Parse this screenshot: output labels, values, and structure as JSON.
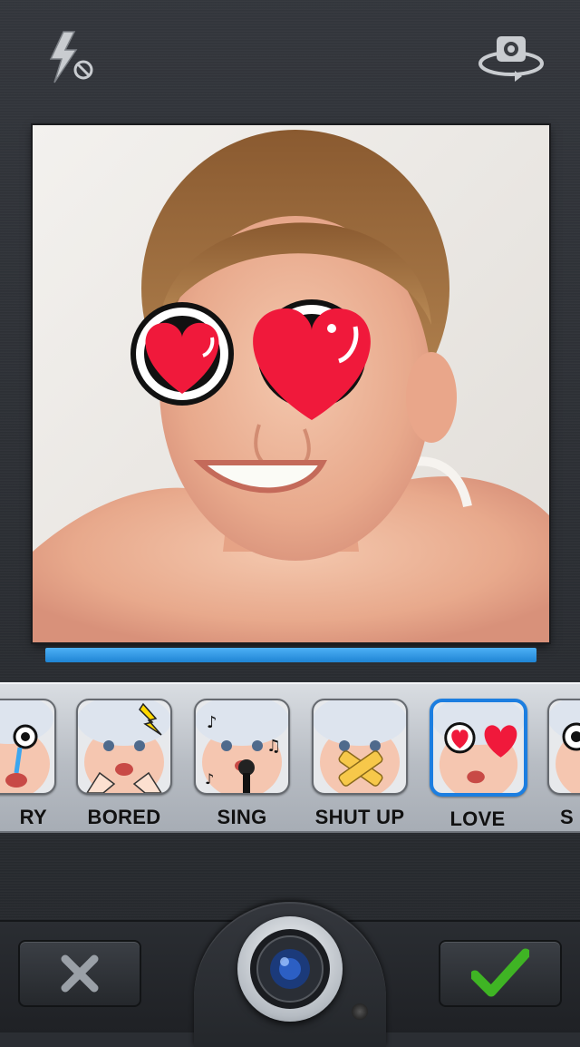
{
  "topbar": {
    "flash_icon": "flash-off-icon",
    "switch_camera_icon": "switch-camera-icon"
  },
  "preview": {
    "overlay": "heart-eyes",
    "progress": 1.0,
    "accent": "#1f84d4"
  },
  "stickers": [
    {
      "label": "CRY",
      "shown_label": "RY",
      "icon": "cry-face"
    },
    {
      "label": "BORED",
      "icon": "bored-face"
    },
    {
      "label": "SING",
      "icon": "sing-face"
    },
    {
      "label": "SHUT UP",
      "icon": "shut-up-face"
    },
    {
      "label": "LOVE",
      "icon": "love-face",
      "selected": true
    },
    {
      "label": "S",
      "icon": "surprise-face"
    }
  ],
  "bottom": {
    "cancel_icon": "close-icon",
    "capture_icon": "camera-lens-icon",
    "confirm_icon": "checkmark-icon",
    "confirm_color": "#3fb424"
  }
}
